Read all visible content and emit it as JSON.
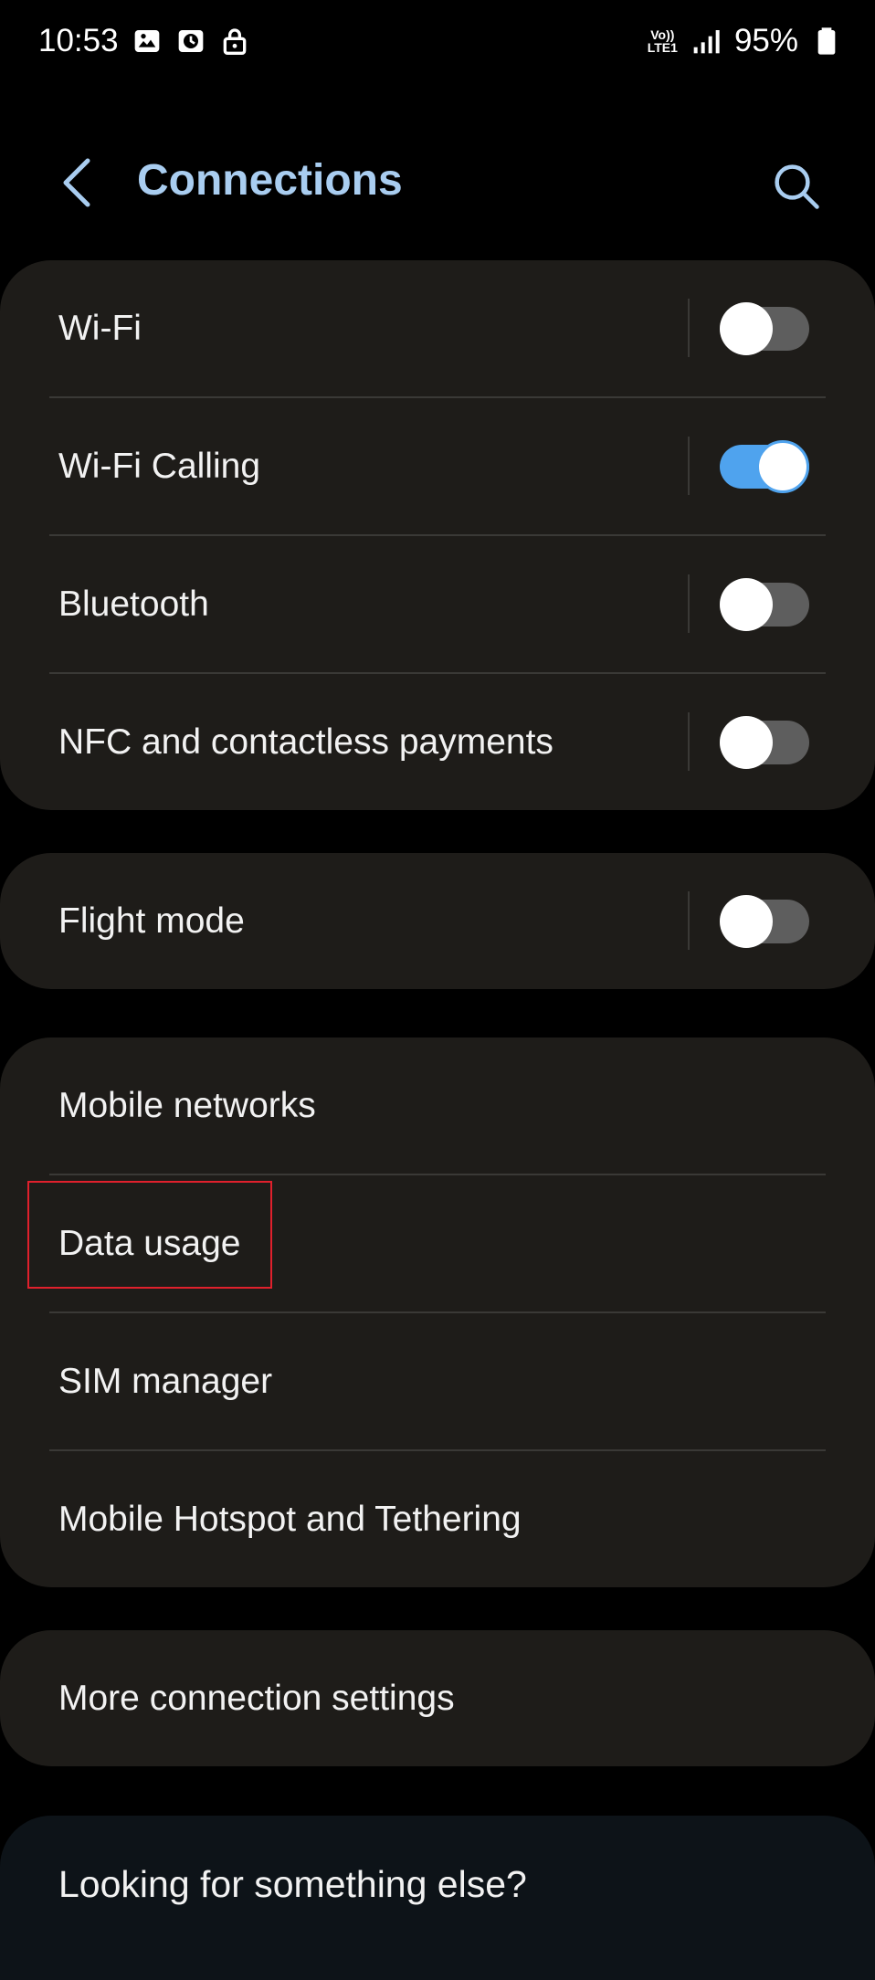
{
  "status_bar": {
    "time": "10:53",
    "battery": "95%",
    "volte_top": "Vo))",
    "volte_bottom": "LTE1"
  },
  "header": {
    "title": "Connections"
  },
  "groups": {
    "wireless": [
      {
        "label": "Wi-Fi",
        "toggle": "off"
      },
      {
        "label": "Wi-Fi Calling",
        "toggle": "on"
      },
      {
        "label": "Bluetooth",
        "toggle": "off"
      },
      {
        "label": "NFC and contactless payments",
        "toggle": "off"
      }
    ],
    "flight": [
      {
        "label": "Flight mode",
        "toggle": "off"
      }
    ],
    "mobile": [
      {
        "label": "Mobile networks"
      },
      {
        "label": "Data usage"
      },
      {
        "label": "SIM manager"
      },
      {
        "label": "Mobile Hotspot and Tethering"
      }
    ],
    "more": [
      {
        "label": "More connection settings"
      }
    ],
    "looking": {
      "label": "Looking for something else?"
    }
  },
  "colors": {
    "accent": "#4fa3ee",
    "title": "#a9cdf0",
    "card": "#1e1c19",
    "highlight": "#e0202c"
  }
}
